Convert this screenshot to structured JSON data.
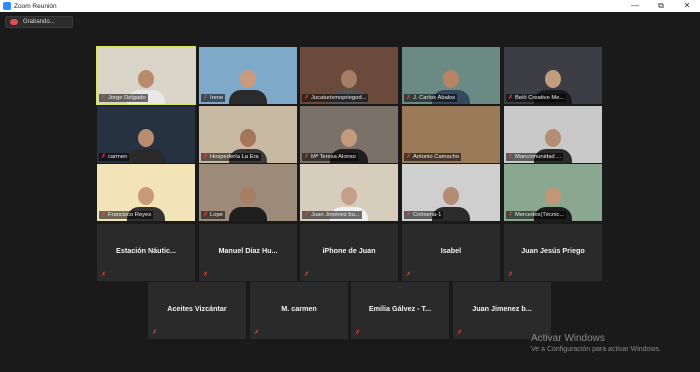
{
  "window": {
    "title": "Zoom Reunión",
    "minimize": "—",
    "maximize": "⧉",
    "close": "✕"
  },
  "recording": {
    "label": "Grabando..."
  },
  "tiles_row1": [
    {
      "name": "Jorge Delgado",
      "active": true,
      "bg": "#d9d4c8",
      "skin": "#b98b6a",
      "shirt": "#e8e8e8"
    },
    {
      "name": "Irene",
      "bg": "#7fa9c9",
      "skin": "#c99a7c",
      "shirt": "#2b2b2b"
    },
    {
      "name": "Jucaturismopriegod...",
      "bg": "#6a4a3a",
      "skin": "#a57e63",
      "shirt": "#555"
    },
    {
      "name": "J. Carlos Ábalos",
      "bg": "#6c8a84",
      "skin": "#b78566",
      "shirt": "#34495e"
    },
    {
      "name": "Belö Creative Me...",
      "bg": "#3d3d46",
      "skin": "#c19c7f",
      "shirt": "#1a1a1a"
    }
  ],
  "tiles_row2": [
    {
      "name": "carmen",
      "bg": "#263240",
      "skin": "#b98c70",
      "shirt": "#2a2a2a"
    },
    {
      "name": "Hospedería La Era",
      "bg": "#c8b9a3",
      "skin": "#a6765a",
      "shirt": "#3a3a3a"
    },
    {
      "name": "Mª Teresa Alonso",
      "bg": "#7a7168",
      "skin": "#c49a7e",
      "shirt": "#1f1f1f"
    },
    {
      "name": "Antonio Camacho",
      "bg": "#9a7a58",
      "skin": "#9a7a58",
      "shirt": "#9a7a58"
    },
    {
      "name": "Mancomunidad ...",
      "bg": "#c9c9c9",
      "skin": "#b48e72",
      "shirt": "#2c2c2c"
    }
  ],
  "tiles_row3": [
    {
      "name": "Francisco Reyes",
      "bg": "#f2e3b8",
      "skin": "#c79a7a",
      "shirt": "#333"
    },
    {
      "name": "Lope",
      "bg": "#9b8b78",
      "skin": "#a77e62",
      "shirt": "#1e1e1e"
    },
    {
      "name": "Juan Jiménez bu...",
      "bg": "#d7cdbd",
      "skin": "#c5a088",
      "shirt": "#f0f0f0"
    },
    {
      "name": "Colmena-1",
      "bg": "#cfcfcf",
      "skin": "#b28c74",
      "shirt": "#2b2b2b"
    },
    {
      "name": "Mercedes(Técnic...",
      "bg": "#8aa78f",
      "skin": "#c29677",
      "shirt": "#1c1c1c"
    }
  ],
  "audio_row4": [
    "Estación  Náutic...",
    "Manuel  Díaz  Hu...",
    "iPhone de Juan",
    "Isabel",
    "Juan Jesús Priego"
  ],
  "audio_row5": [
    "Aceites Vizcántar",
    "M. carmen",
    "Emilia Gálvez - T...",
    "Juan Jimenez b..."
  ],
  "watermark": {
    "line1": "Activar Windows",
    "line2": "Ve a Configuración para activar Windows."
  },
  "icons": {
    "mic_muted": "✗"
  }
}
